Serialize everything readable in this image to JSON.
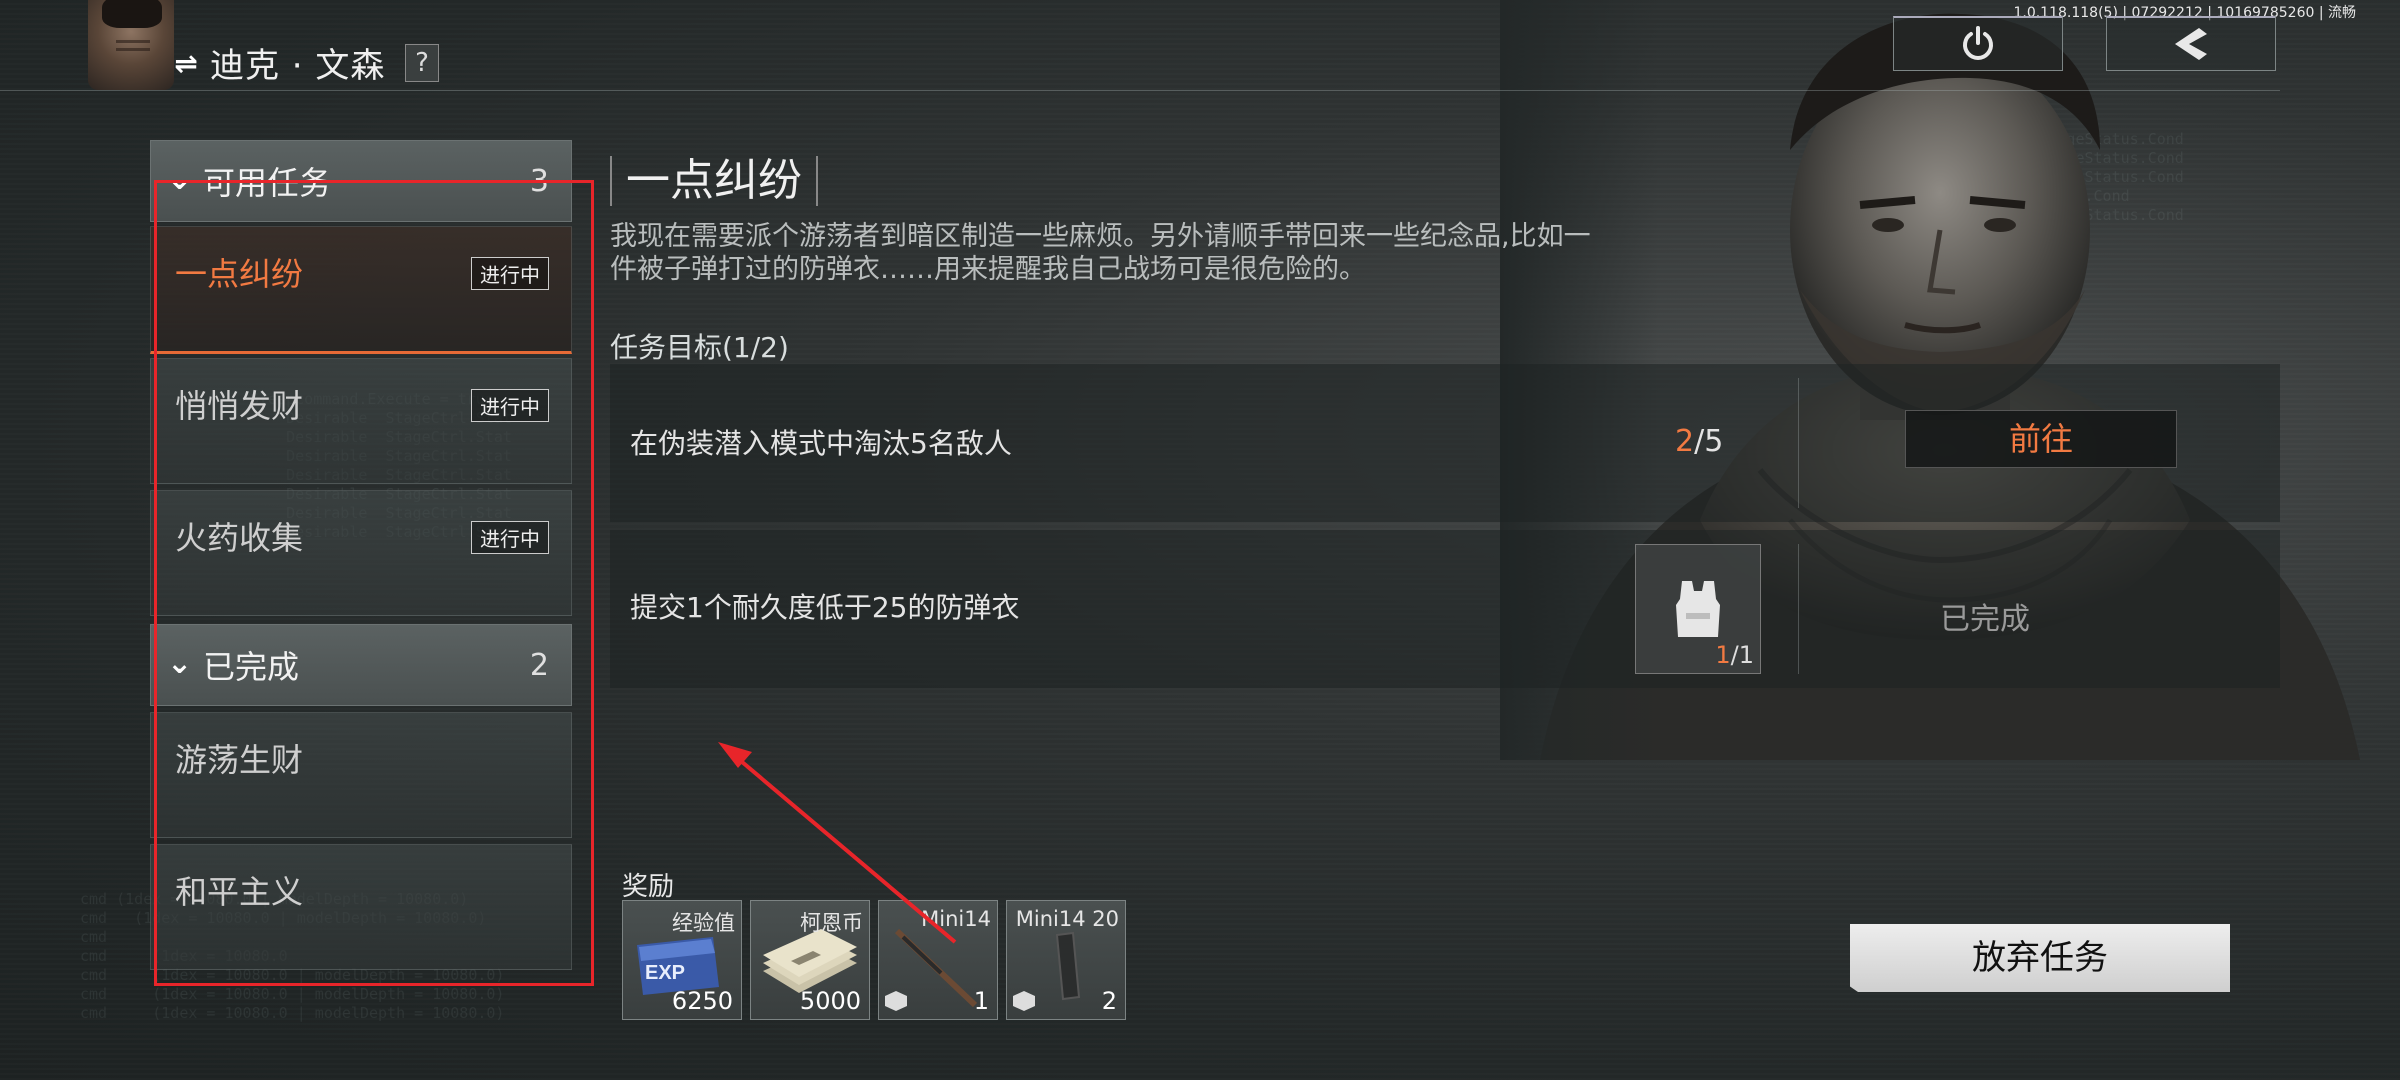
{
  "header": {
    "character_name": "迪克 · 文森",
    "help_label": "?",
    "version": "1.0.118.118(5) | 07292212 | 10169785260 | 流畅",
    "swap_symbol": "⇌",
    "power_icon": "power-icon",
    "back_icon": "back-arrow-icon"
  },
  "sidebar": {
    "available": {
      "label": "可用任务",
      "count": "3"
    },
    "available_items": [
      {
        "name": "一点纠纷",
        "status": "进行中",
        "active": true
      },
      {
        "name": "悄悄发财",
        "status": "进行中",
        "active": false
      },
      {
        "name": "火药收集",
        "status": "进行中",
        "active": false
      }
    ],
    "completed": {
      "label": "已完成",
      "count": "2"
    },
    "completed_items": [
      {
        "name": "游荡生财"
      },
      {
        "name": "和平主义"
      }
    ]
  },
  "mission": {
    "title": "一点纠纷",
    "description": "我现在需要派个游荡者到暗区制造一些麻烦。另外请顺手带回来一些纪念品,比如一件被子弹打过的防弹衣……用来提醒我自己战场可是很危险的。",
    "objectives_heading": "任务目标(1/2)",
    "objectives": [
      {
        "text": "在伪装潜入模式中淘汰5名敌人",
        "current": "2",
        "total": "/5",
        "action": "前往"
      },
      {
        "text": "提交1个耐久度低于25的防弹衣",
        "item_current": "1",
        "item_total": "/1",
        "item_icon": "armor-vest-icon",
        "status": "已完成"
      }
    ]
  },
  "rewards": {
    "heading": "奖励",
    "items": [
      {
        "name": "经验值",
        "qty": "6250",
        "icon": "exp-icon"
      },
      {
        "name": "柯恩币",
        "qty": "5000",
        "icon": "cash-stack-icon"
      },
      {
        "name": "Mini14",
        "qty": "1",
        "icon": "rifle-icon"
      },
      {
        "name": "Mini14 20",
        "qty": "2",
        "icon": "magazine-icon"
      }
    ]
  },
  "actions": {
    "abandon": "放弃任务"
  },
  "colors": {
    "accent": "#f27a42",
    "highlight_box": "#e8252a"
  }
}
